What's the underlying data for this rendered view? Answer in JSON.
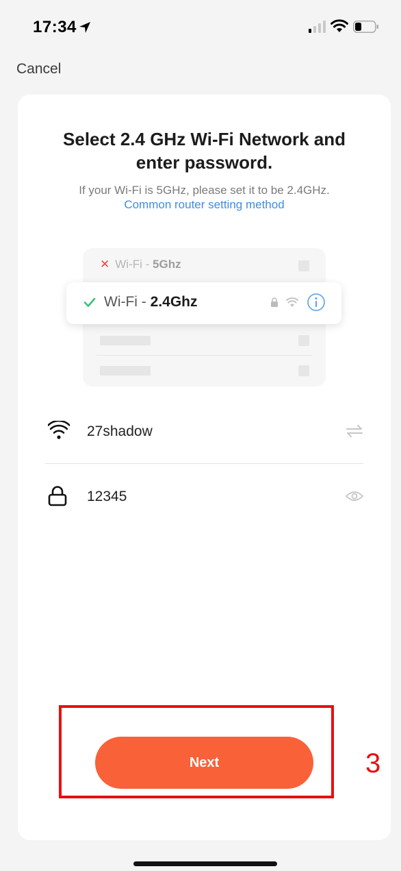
{
  "status_bar": {
    "time": "17:34",
    "icons": [
      "location-arrow-icon",
      "cellular-signal-icon",
      "wifi-icon",
      "battery-icon"
    ]
  },
  "nav": {
    "cancel_label": "Cancel"
  },
  "header": {
    "title_line1": "Select 2.4 GHz Wi-Fi Network and",
    "title_line2": "enter password.",
    "subtitle": "If your Wi-Fi is 5GHz, please set it to be 2.4GHz.",
    "help_link": "Common router setting method"
  },
  "illustration": {
    "bad_network_prefix": "Wi-Fi - ",
    "bad_network_band": "5Ghz",
    "good_network_prefix": "Wi-Fi - ",
    "good_network_band": "2.4Ghz"
  },
  "form": {
    "ssid_value": "27shadow",
    "password_value": "12345"
  },
  "actions": {
    "next_label": "Next"
  },
  "annotation": {
    "step_number": "3"
  },
  "colors": {
    "accent": "#f96138",
    "link": "#3d8ee0",
    "annotation": "#e80f0f",
    "check": "#34c07a",
    "error": "#e5484d"
  }
}
